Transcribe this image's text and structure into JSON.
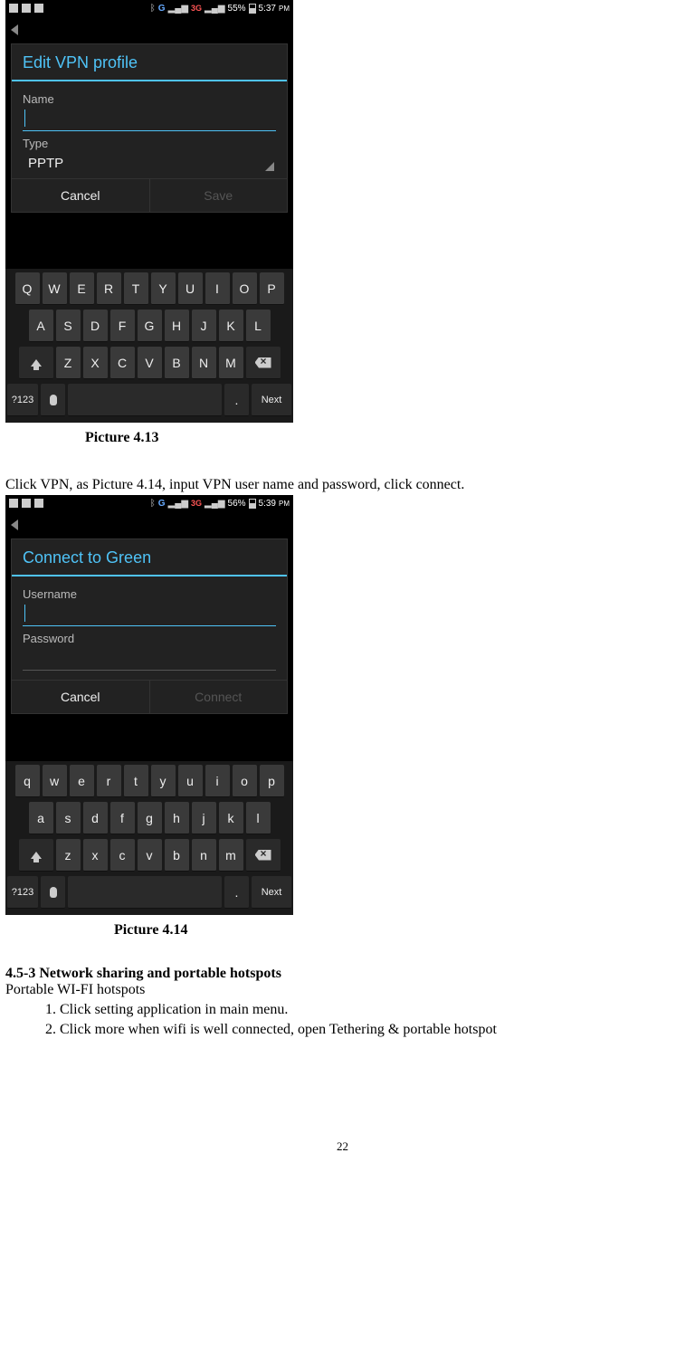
{
  "screenshot1": {
    "status": {
      "battery_pct": "55%",
      "time": "5:37",
      "ampm": "PM",
      "net_g": "G",
      "net_3g": "3G"
    },
    "dialog": {
      "title": "Edit VPN profile",
      "name_label": "Name",
      "type_label": "Type",
      "type_value": "PPTP",
      "cancel": "Cancel",
      "save": "Save"
    },
    "keyboard": {
      "row1": [
        "Q",
        "W",
        "E",
        "R",
        "T",
        "Y",
        "U",
        "I",
        "O",
        "P"
      ],
      "row2": [
        "A",
        "S",
        "D",
        "F",
        "G",
        "H",
        "J",
        "K",
        "L"
      ],
      "row3": [
        "Z",
        "X",
        "C",
        "V",
        "B",
        "N",
        "M"
      ],
      "num_key": "?123",
      "dot_key": ".",
      "next_key": "Next"
    }
  },
  "caption1": "Picture 4.13",
  "para1": "Click VPN, as Picture 4.14, input VPN user name and password, click connect.",
  "screenshot2": {
    "status": {
      "battery_pct": "56%",
      "time": "5:39",
      "ampm": "PM",
      "net_g": "G",
      "net_3g": "3G"
    },
    "dialog": {
      "title": "Connect to Green",
      "username_label": "Username",
      "password_label": "Password",
      "cancel": "Cancel",
      "connect": "Connect"
    },
    "keyboard": {
      "row1": [
        "q",
        "w",
        "e",
        "r",
        "t",
        "y",
        "u",
        "i",
        "o",
        "p"
      ],
      "row2": [
        "a",
        "s",
        "d",
        "f",
        "g",
        "h",
        "j",
        "k",
        "l"
      ],
      "row3": [
        "z",
        "x",
        "c",
        "v",
        "b",
        "n",
        "m"
      ],
      "num_key": "?123",
      "dot_key": ".",
      "next_key": "Next"
    }
  },
  "caption2": "Picture 4.14",
  "section_head": "4.5-3 Network sharing and portable hotspots",
  "section_sub": "Portable WI-FI hotspots",
  "list": {
    "item1": "Click setting application in main menu.",
    "item2": "Click more when wifi is well connected, open Tethering & portable hotspot"
  },
  "page_num": "22"
}
